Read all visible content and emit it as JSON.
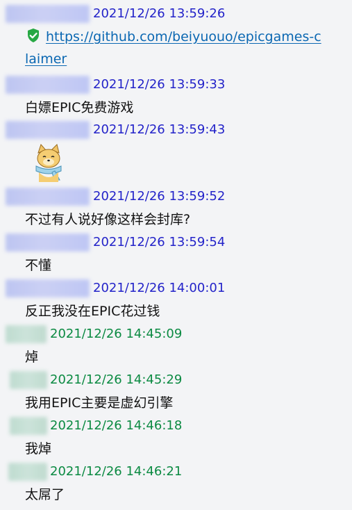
{
  "chat": {
    "messages": [
      {
        "timestamp": "2021/12/26 13:59:26",
        "type": "link",
        "content": "https://github.com/beiyuouo/epicgames-claimer",
        "link_icon": "shield-check-icon",
        "name_color": "#2323c9"
      },
      {
        "timestamp": "2021/12/26 13:59:33",
        "type": "text",
        "content": "白嫖EPIC免费游戏",
        "name_color": "#2323c9"
      },
      {
        "timestamp": "2021/12/26 13:59:43",
        "type": "sticker",
        "content": "cartoon-dog-sticker",
        "name_color": "#2323c9"
      },
      {
        "timestamp": "2021/12/26 13:59:52",
        "type": "text",
        "content": "不过有人说好像这样会封库?",
        "name_color": "#2323c9"
      },
      {
        "timestamp": "2021/12/26 13:59:54",
        "type": "text",
        "content": "不懂",
        "name_color": "#2323c9"
      },
      {
        "timestamp": "2021/12/26 14:00:01",
        "type": "text",
        "content": "反正我没在EPIC花过钱",
        "name_color": "#2323c9"
      },
      {
        "timestamp": "2021/12/26 14:45:09",
        "type": "text",
        "content": "焯",
        "name_color": "#0b8a42"
      },
      {
        "timestamp": "2021/12/26 14:45:29",
        "type": "text",
        "content": "我用EPIC主要是虚幻引擎",
        "name_color": "#0b8a42"
      },
      {
        "timestamp": "2021/12/26 14:46:18",
        "type": "text",
        "content": "我焯",
        "name_color": "#0b8a42"
      },
      {
        "timestamp": "2021/12/26 14:46:21",
        "type": "text",
        "content": "太屌了",
        "name_color": "#0b8a42"
      }
    ]
  }
}
